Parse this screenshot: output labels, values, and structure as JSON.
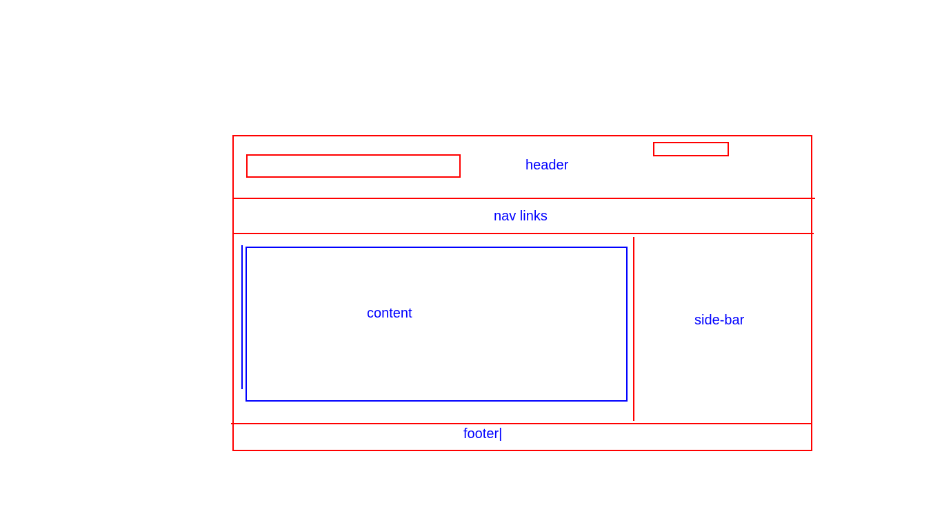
{
  "labels": {
    "header": "header",
    "nav": "nav links",
    "content": "content",
    "sidebar": "side-bar",
    "footer": "footer|"
  },
  "colors": {
    "outline": "#ff0000",
    "text": "#0000ff",
    "content_box": "#0000ff",
    "background": "#ffffff"
  }
}
